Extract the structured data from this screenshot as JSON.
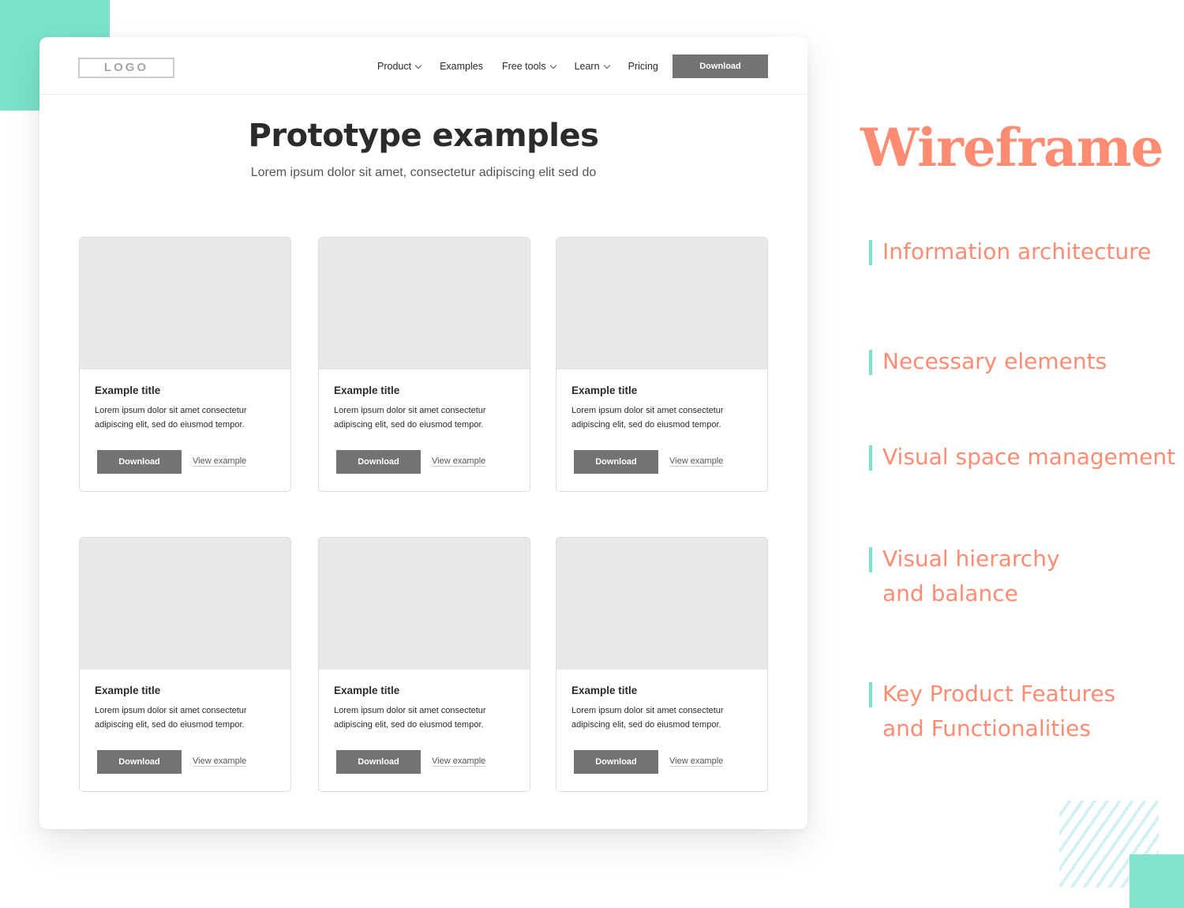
{
  "colors": {
    "accent_teal": "#7ae3c9",
    "accent_coral": "#fd8c73",
    "button_gray": "#737373",
    "placeholder_gray": "#e8e8e8"
  },
  "navbar": {
    "logo": "LOGO",
    "items": [
      {
        "label": "Product",
        "has_dropdown": true,
        "icon": "chevron-down-icon"
      },
      {
        "label": "Examples",
        "has_dropdown": false
      },
      {
        "label": "Free tools",
        "has_dropdown": true,
        "icon": "chevron-down-icon"
      },
      {
        "label": "Learn",
        "has_dropdown": true,
        "icon": "chevron-down-icon"
      },
      {
        "label": "Pricing",
        "has_dropdown": false
      }
    ],
    "cta_label": "Download"
  },
  "hero": {
    "title": "Prototype examples",
    "subtitle": "Lorem ipsum dolor sit amet, consectetur adipiscing elit sed do"
  },
  "cards": [
    {
      "title": "Example title",
      "description": "Lorem ipsum dolor sit amet consectetur adipiscing elit, sed do eiusmod tempor.",
      "download_label": "Download",
      "link_label": "View example"
    },
    {
      "title": "Example title",
      "description": "Lorem ipsum dolor sit amet consectetur adipiscing elit, sed do eiusmod tempor.",
      "download_label": "Download",
      "link_label": "View example"
    },
    {
      "title": "Example title",
      "description": "Lorem ipsum dolor sit amet consectetur adipiscing elit, sed do eiusmod tempor.",
      "download_label": "Download",
      "link_label": "View example"
    },
    {
      "title": "Example title",
      "description": "Lorem ipsum dolor sit amet consectetur adipiscing elit, sed do eiusmod tempor.",
      "download_label": "Download",
      "link_label": "View example"
    },
    {
      "title": "Example title",
      "description": "Lorem ipsum dolor sit amet consectetur adipiscing elit, sed do eiusmod tempor.",
      "download_label": "Download",
      "link_label": "View example"
    },
    {
      "title": "Example title",
      "description": "Lorem ipsum dolor sit amet consectetur adipiscing elit, sed do eiusmod tempor.",
      "download_label": "Download",
      "link_label": "View example"
    }
  ],
  "sidebar": {
    "title": "Wireframe",
    "items": [
      {
        "label": "Information architecture"
      },
      {
        "label": "Necessary elements"
      },
      {
        "label": "Visual space management"
      },
      {
        "label": "Visual hierarchy\nand balance"
      },
      {
        "label": "Key Product Features\nand Functionalities"
      }
    ]
  }
}
